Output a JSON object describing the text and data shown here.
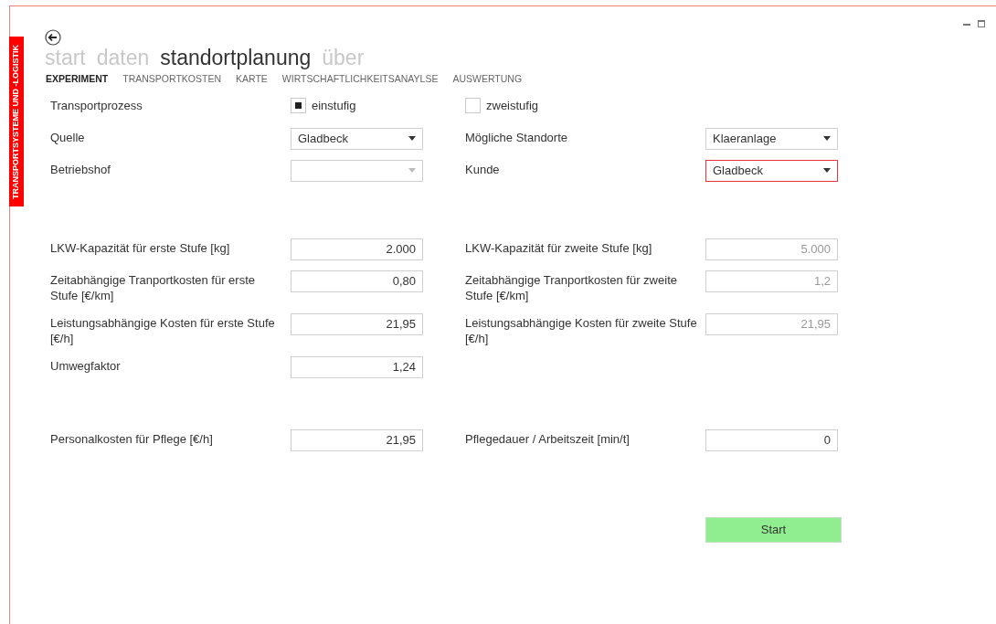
{
  "sidebar_label": "TRANSPORTSYSTEME UND -LOGISTIK",
  "nav": [
    {
      "label": "start",
      "selected": false
    },
    {
      "label": "daten",
      "selected": false
    },
    {
      "label": "standortplanung",
      "selected": true
    },
    {
      "label": "über",
      "selected": false
    }
  ],
  "tabs": [
    {
      "label": "EXPERIMENT",
      "selected": true
    },
    {
      "label": "TRANSPORTKOSTEN",
      "selected": false
    },
    {
      "label": "KARTE",
      "selected": false
    },
    {
      "label": "WIRTSCHAFTLICHKEITSANAYLSE",
      "selected": false
    },
    {
      "label": "AUSWERTUNG",
      "selected": false
    }
  ],
  "sections": [
    [
      {
        "left": {
          "label": "Transportprozess",
          "field": {
            "kind": "checkbox",
            "label": "einstufig",
            "checked": true
          }
        },
        "right": {
          "field": {
            "kind": "checkbox",
            "label": "zweistufig",
            "checked": false
          }
        }
      },
      {
        "left": {
          "label": "Quelle",
          "field": {
            "kind": "dropdown",
            "value": "Gladbeck",
            "disabled": false,
            "invalid": false
          }
        },
        "right": {
          "label": "Mögliche Standorte",
          "field": {
            "kind": "dropdown",
            "value": "Klaeranlage",
            "disabled": false,
            "invalid": false
          }
        }
      },
      {
        "left": {
          "label": "Betriebshof",
          "field": {
            "kind": "dropdown",
            "disabled": true,
            "invalid": false
          }
        },
        "right": {
          "label": "Kunde",
          "field": {
            "kind": "dropdown",
            "value": "Gladbeck",
            "disabled": false,
            "invalid": true
          }
        }
      }
    ],
    [
      {
        "left": {
          "label": "LKW-Kapazität für erste Stufe [kg]",
          "field": {
            "kind": "text",
            "value": "2.000",
            "disabled": false
          }
        },
        "right": {
          "label": "LKW-Kapazität für zweite Stufe [kg]",
          "field": {
            "kind": "text",
            "value": "5.000",
            "disabled": true
          }
        }
      },
      {
        "left": {
          "label": "Zeitabhängige Tranportkosten für erste Stufe [€/km]",
          "field": {
            "kind": "text",
            "value": "0,80",
            "disabled": false
          }
        },
        "right": {
          "label": "Zeitabhängige Tranportkosten für zweite Stufe [€/km]",
          "field": {
            "kind": "text",
            "value": "1,2",
            "disabled": true
          }
        }
      },
      {
        "left": {
          "label": "Leistungsabhängige Kosten für erste Stufe [€/h]",
          "field": {
            "kind": "text",
            "value": "21,95",
            "disabled": false
          }
        },
        "right": {
          "label": "Leistungsabhängige Kosten für zweite Stufe [€/h]",
          "field": {
            "kind": "text",
            "value": "21,95",
            "disabled": true
          }
        }
      },
      {
        "left": {
          "label": "Umwegfaktor",
          "field": {
            "kind": "text",
            "value": "1,24",
            "disabled": false
          }
        }
      }
    ],
    [
      {
        "left": {
          "label": "Personalkosten für Pflege [€/h]",
          "field": {
            "kind": "text",
            "value": "21,95",
            "disabled": false
          }
        },
        "right": {
          "label": "Pflegedauer / Arbeitszeit [min/t]",
          "field": {
            "kind": "text",
            "value": "0",
            "disabled": false
          }
        }
      }
    ]
  ],
  "start_button": "Start"
}
